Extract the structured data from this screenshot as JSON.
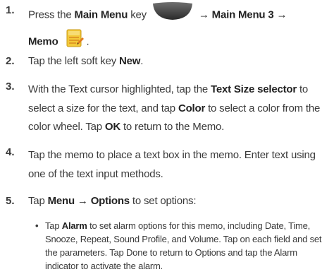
{
  "steps": [
    {
      "number": "1.",
      "press": "Press the",
      "main_menu_key_label": "Main Menu",
      "key_word": "key",
      "arrow1": "→",
      "main_menu_3": "Main Menu 3",
      "arrow2": "→",
      "memo": "Memo"
    },
    {
      "number": "2.",
      "text": "Tap the left soft key",
      "key": "New",
      "end": "."
    },
    {
      "number": "3.",
      "part1": "With the Text cursor highlighted, tap the",
      "text_size_selector": "Text Size selector",
      "part2": "to select a size for the text, and tap",
      "color": "Color",
      "part3": "to select a color from the color wheel. Tap",
      "ok": "OK",
      "part4": "to return to the Memo."
    },
    {
      "number": "4.",
      "text": "Tap the memo to place a text box in the memo.  Enter text using one of the text input methods."
    },
    {
      "number": "5.",
      "tap": "Tap",
      "menu": "Menu",
      "arrow": "→",
      "options": "Options",
      "end": "to set options:"
    }
  ],
  "bullet": {
    "dot": "•",
    "tap": "Tap",
    "alarm": "Alarm",
    "text": "to set alarm options for this memo, including Date, Time, Snooze, Repeat, Sound Profile, and Volume.  Tap on each field and set the parameters.  Tap Done to return to Options and tap the Alarm indicator to activate the alarm."
  },
  "icons": {
    "main_menu_key": "main-menu-key-icon",
    "memo": "memo-icon"
  }
}
